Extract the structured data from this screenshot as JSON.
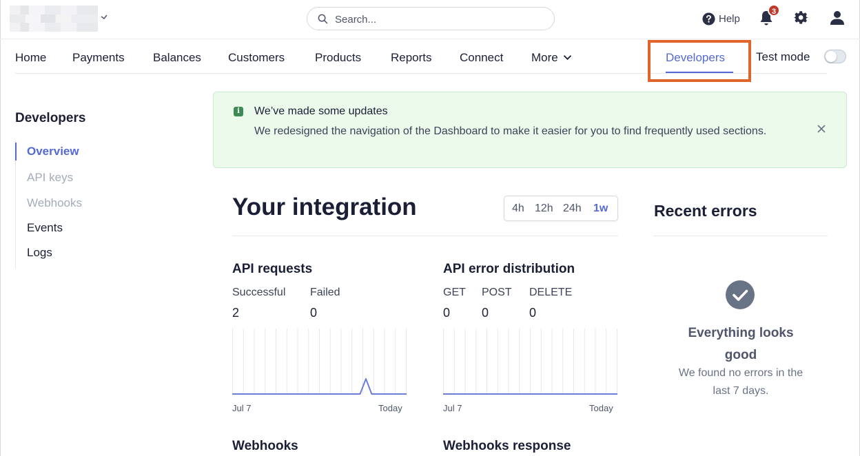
{
  "topbar": {
    "search_placeholder": "Search...",
    "help_label": "Help",
    "notifications_count": "3"
  },
  "nav": {
    "items": [
      "Home",
      "Payments",
      "Balances",
      "Customers",
      "Products",
      "Reports",
      "Connect",
      "More"
    ],
    "active": "Developers",
    "test_mode_label": "Test mode",
    "test_mode_on": false,
    "highlight_color": "#e0652a",
    "accent_color": "#5469d4"
  },
  "sidebar": {
    "title": "Developers",
    "items": [
      "Overview",
      "API keys",
      "Webhooks",
      "Events",
      "Logs"
    ]
  },
  "banner": {
    "title": "We’ve made some updates",
    "body": "We redesigned the navigation of the Dashboard to make it easier for you to find frequently used sections."
  },
  "integration": {
    "title": "Your integration",
    "ranges": [
      "4h",
      "12h",
      "24h",
      "1w"
    ],
    "active_range": "1w"
  },
  "api_requests": {
    "title": "API requests",
    "metrics": [
      {
        "label": "Successful",
        "value": "2"
      },
      {
        "label": "Failed",
        "value": "0"
      }
    ],
    "chart_data": {
      "type": "line",
      "x_start_label": "Jul 7",
      "x_end_label": "Today",
      "values": [
        0,
        0,
        0,
        0,
        0,
        0,
        0,
        0,
        0,
        0,
        0,
        0,
        0,
        0,
        0,
        0,
        0,
        0,
        0,
        0,
        0,
        0,
        0,
        2,
        0,
        0,
        0,
        0,
        0,
        0,
        0
      ]
    }
  },
  "api_errors": {
    "title": "API error distribution",
    "metrics": [
      {
        "label": "GET",
        "value": "0"
      },
      {
        "label": "POST",
        "value": "0"
      },
      {
        "label": "DELETE",
        "value": "0"
      }
    ],
    "chart_data": {
      "type": "line",
      "x_start_label": "Jul 7",
      "x_end_label": "Today",
      "values": [
        0,
        0,
        0,
        0,
        0,
        0,
        0,
        0,
        0,
        0,
        0,
        0,
        0,
        0,
        0,
        0,
        0,
        0,
        0,
        0,
        0,
        0,
        0,
        0,
        0,
        0,
        0,
        0,
        0,
        0,
        0
      ]
    }
  },
  "webhooks": {
    "title": "Webhooks",
    "response_title": "Webhooks response"
  },
  "recent_errors": {
    "title": "Recent errors",
    "status_title": "Everything looks good",
    "status_body": "We found no errors in the last 7 days."
  }
}
